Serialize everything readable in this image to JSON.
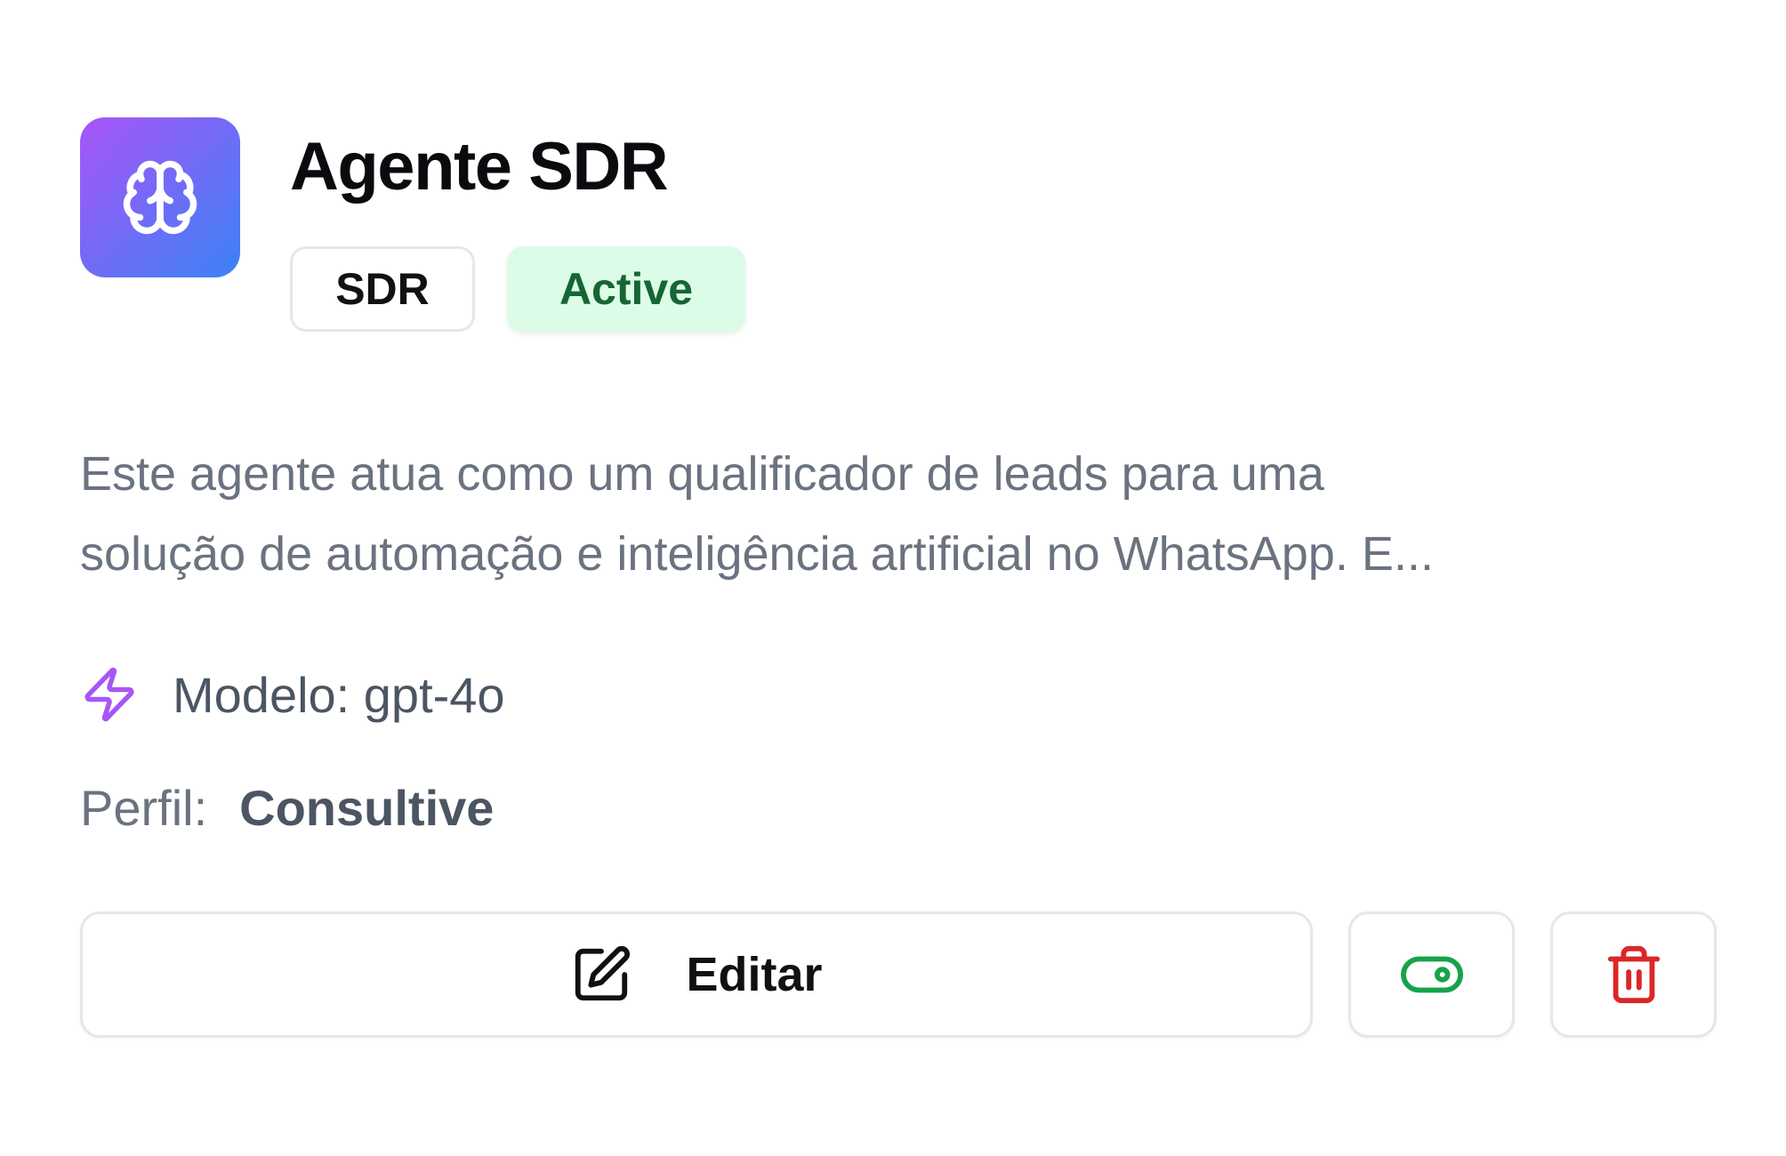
{
  "agent": {
    "name": "Agente SDR",
    "type_badge": "SDR",
    "status_badge": "Active",
    "description_line1": "Este agente atua como um qualificador de leads para uma",
    "description_line2": "solução de automação e inteligência artificial no WhatsApp. E...",
    "model_text": "Modelo: gpt-4o",
    "profile_label": "Perfil:",
    "profile_value": "Consultive"
  },
  "actions": {
    "edit_label": "Editar"
  },
  "icons": {
    "avatar": "brain-icon",
    "model": "zap-icon",
    "edit": "edit-icon",
    "toggle": "toggle-icon",
    "delete": "trash-icon"
  },
  "colors": {
    "avatar_gradient_start": "#a855f7",
    "avatar_gradient_end": "#3b82f6",
    "status_bg": "#dcfce7",
    "status_text": "#166534",
    "model_icon": "#a855f7",
    "toggle_icon": "#16a34a",
    "delete_icon": "#dc2626"
  }
}
